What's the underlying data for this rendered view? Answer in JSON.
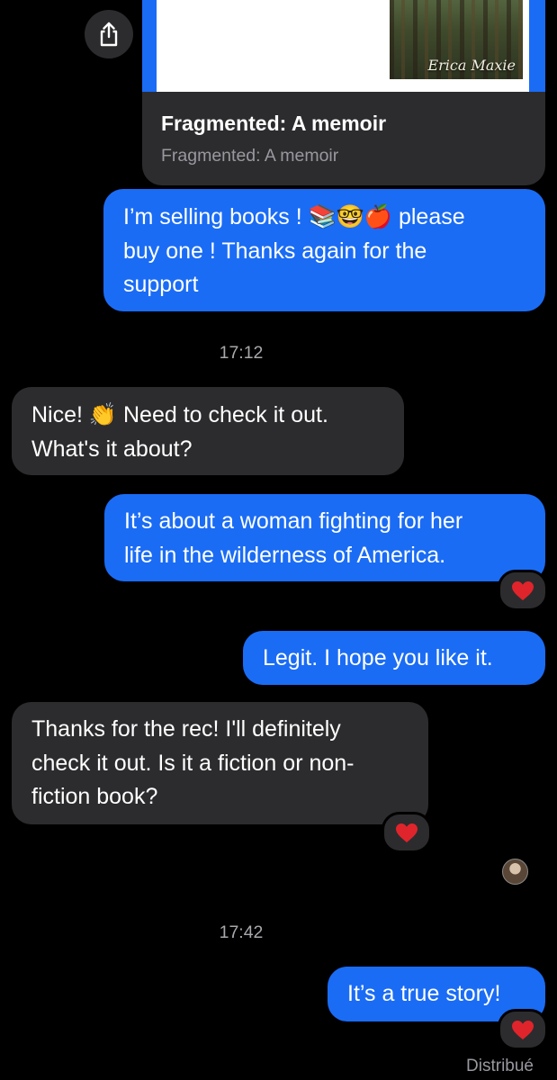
{
  "link_preview": {
    "cover_author": "Erica Maxie",
    "title": "Fragmented: A memoir",
    "subtitle": "Fragmented: A memoir"
  },
  "messages": [
    {
      "id": "m1",
      "direction": "outgoing",
      "line1_a": "I’m selling books ! ",
      "line1_emoji": "📚🤓🍎",
      "line1_b": " please",
      "line2": "buy one ! Thanks again for the",
      "line3": "support"
    },
    {
      "id": "m2",
      "direction": "incoming",
      "line1_a": "Nice! ",
      "line1_emoji": "👏",
      "line1_b": " Need to check it out.",
      "line2": "What's it about?"
    },
    {
      "id": "m3",
      "direction": "outgoing",
      "line1": "It’s about a woman fighting for her",
      "line2": "life in the wilderness of America.",
      "reaction": "heart"
    },
    {
      "id": "m4",
      "direction": "outgoing",
      "line1": "Legit. I hope you like it."
    },
    {
      "id": "m5",
      "direction": "incoming",
      "line1": "Thanks for the rec! I'll definitely",
      "line2": "check it out. Is it a fiction or non-",
      "line3": "fiction book?",
      "reaction": "heart"
    },
    {
      "id": "m6",
      "direction": "outgoing",
      "line1": "It’s a true story!",
      "reaction": "heart"
    }
  ],
  "timestamps": [
    "17:12",
    "17:42"
  ],
  "status": "Distribué",
  "icons": {
    "share": "share-icon",
    "reaction": "heart-icon",
    "avatar": "avatar"
  },
  "colors": {
    "outgoing_bubble": "#1a6cf5",
    "incoming_bubble": "#2c2c2e",
    "background": "#000000",
    "heart": "#e0242b"
  }
}
